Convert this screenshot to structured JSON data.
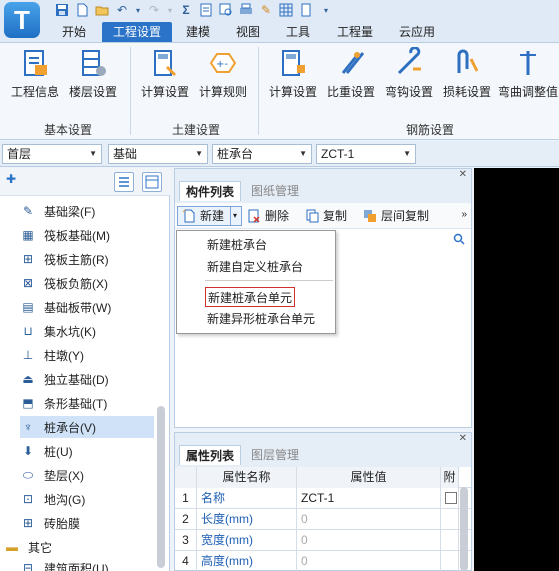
{
  "ribbon_tabs": [
    "开始",
    "工程设置",
    "建模",
    "视图",
    "工具",
    "工程量",
    "云应用"
  ],
  "ribbon": {
    "buttons": [
      {
        "label": "工程信息",
        "icon": "project-info-icon"
      },
      {
        "label": "楼层设置",
        "icon": "floor-settings-icon"
      },
      {
        "label": "计算设置",
        "icon": "calc-settings-icon"
      },
      {
        "label": "计算规则",
        "icon": "calc-rules-icon"
      },
      {
        "label": "计算设置",
        "icon": "rebar-calc-settings-icon"
      },
      {
        "label": "比重设置",
        "icon": "weight-settings-icon"
      },
      {
        "label": "弯钩设置",
        "icon": "hook-settings-icon"
      },
      {
        "label": "损耗设置",
        "icon": "loss-settings-icon"
      },
      {
        "label": "弯曲调整值",
        "icon": "bend-adjust-icon"
      }
    ],
    "groups": [
      "基本设置",
      "土建设置",
      "钢筋设置"
    ]
  },
  "selectors": [
    {
      "value": "首层"
    },
    {
      "value": "基础"
    },
    {
      "value": "桩承台"
    },
    {
      "value": "ZCT-1"
    }
  ],
  "tree": {
    "items": [
      {
        "label": "基础梁(F)",
        "icon": "pencil-icon"
      },
      {
        "label": "筏板基础(M)",
        "icon": "raft-icon"
      },
      {
        "label": "筏板主筋(R)",
        "icon": "raft-main-rebar-icon"
      },
      {
        "label": "筏板负筋(X)",
        "icon": "raft-neg-rebar-icon"
      },
      {
        "label": "基础板带(W)",
        "icon": "strip-icon"
      },
      {
        "label": "集水坑(K)",
        "icon": "sump-icon"
      },
      {
        "label": "柱墩(Y)",
        "icon": "column-pier-icon"
      },
      {
        "label": "独立基础(D)",
        "icon": "isolated-footing-icon"
      },
      {
        "label": "条形基础(T)",
        "icon": "strip-footing-icon"
      },
      {
        "label": "桩承台(V)",
        "icon": "pile-cap-icon"
      },
      {
        "label": "桩(U)",
        "icon": "pile-icon"
      },
      {
        "label": "垫层(X)",
        "icon": "cushion-icon"
      },
      {
        "label": "地沟(G)",
        "icon": "trench-icon"
      },
      {
        "label": "砖胎膜",
        "icon": "brick-mold-icon"
      }
    ],
    "other_folder": "其它",
    "partial_item": "建筑面积(U)"
  },
  "component_panel": {
    "tabs": [
      "构件列表",
      "图纸管理"
    ],
    "toolbar": {
      "new_label": "新建",
      "delete_label": "删除",
      "copy_label": "复制",
      "floor_copy_label": "层间复制"
    },
    "menu": [
      "新建桩承台",
      "新建自定义桩承台",
      "新建桩承台单元",
      "新建异形桩承台单元"
    ]
  },
  "property_panel": {
    "tabs": [
      "属性列表",
      "图层管理"
    ],
    "headers": [
      "属性名称",
      "属性值",
      "附加"
    ],
    "rows": [
      {
        "num": "1",
        "name": "名称",
        "value": "ZCT-1"
      },
      {
        "num": "2",
        "name": "长度(mm)",
        "value": "0"
      },
      {
        "num": "3",
        "name": "宽度(mm)",
        "value": "0"
      },
      {
        "num": "4",
        "name": "高度(mm)",
        "value": "0"
      }
    ],
    "header_third_visible": "附"
  },
  "colors": {
    "active_tab": "#2b73c8",
    "selected_item": "#cfe2f7",
    "link_blue": "#1e5fb4",
    "highlight_box": "#d0312d"
  }
}
